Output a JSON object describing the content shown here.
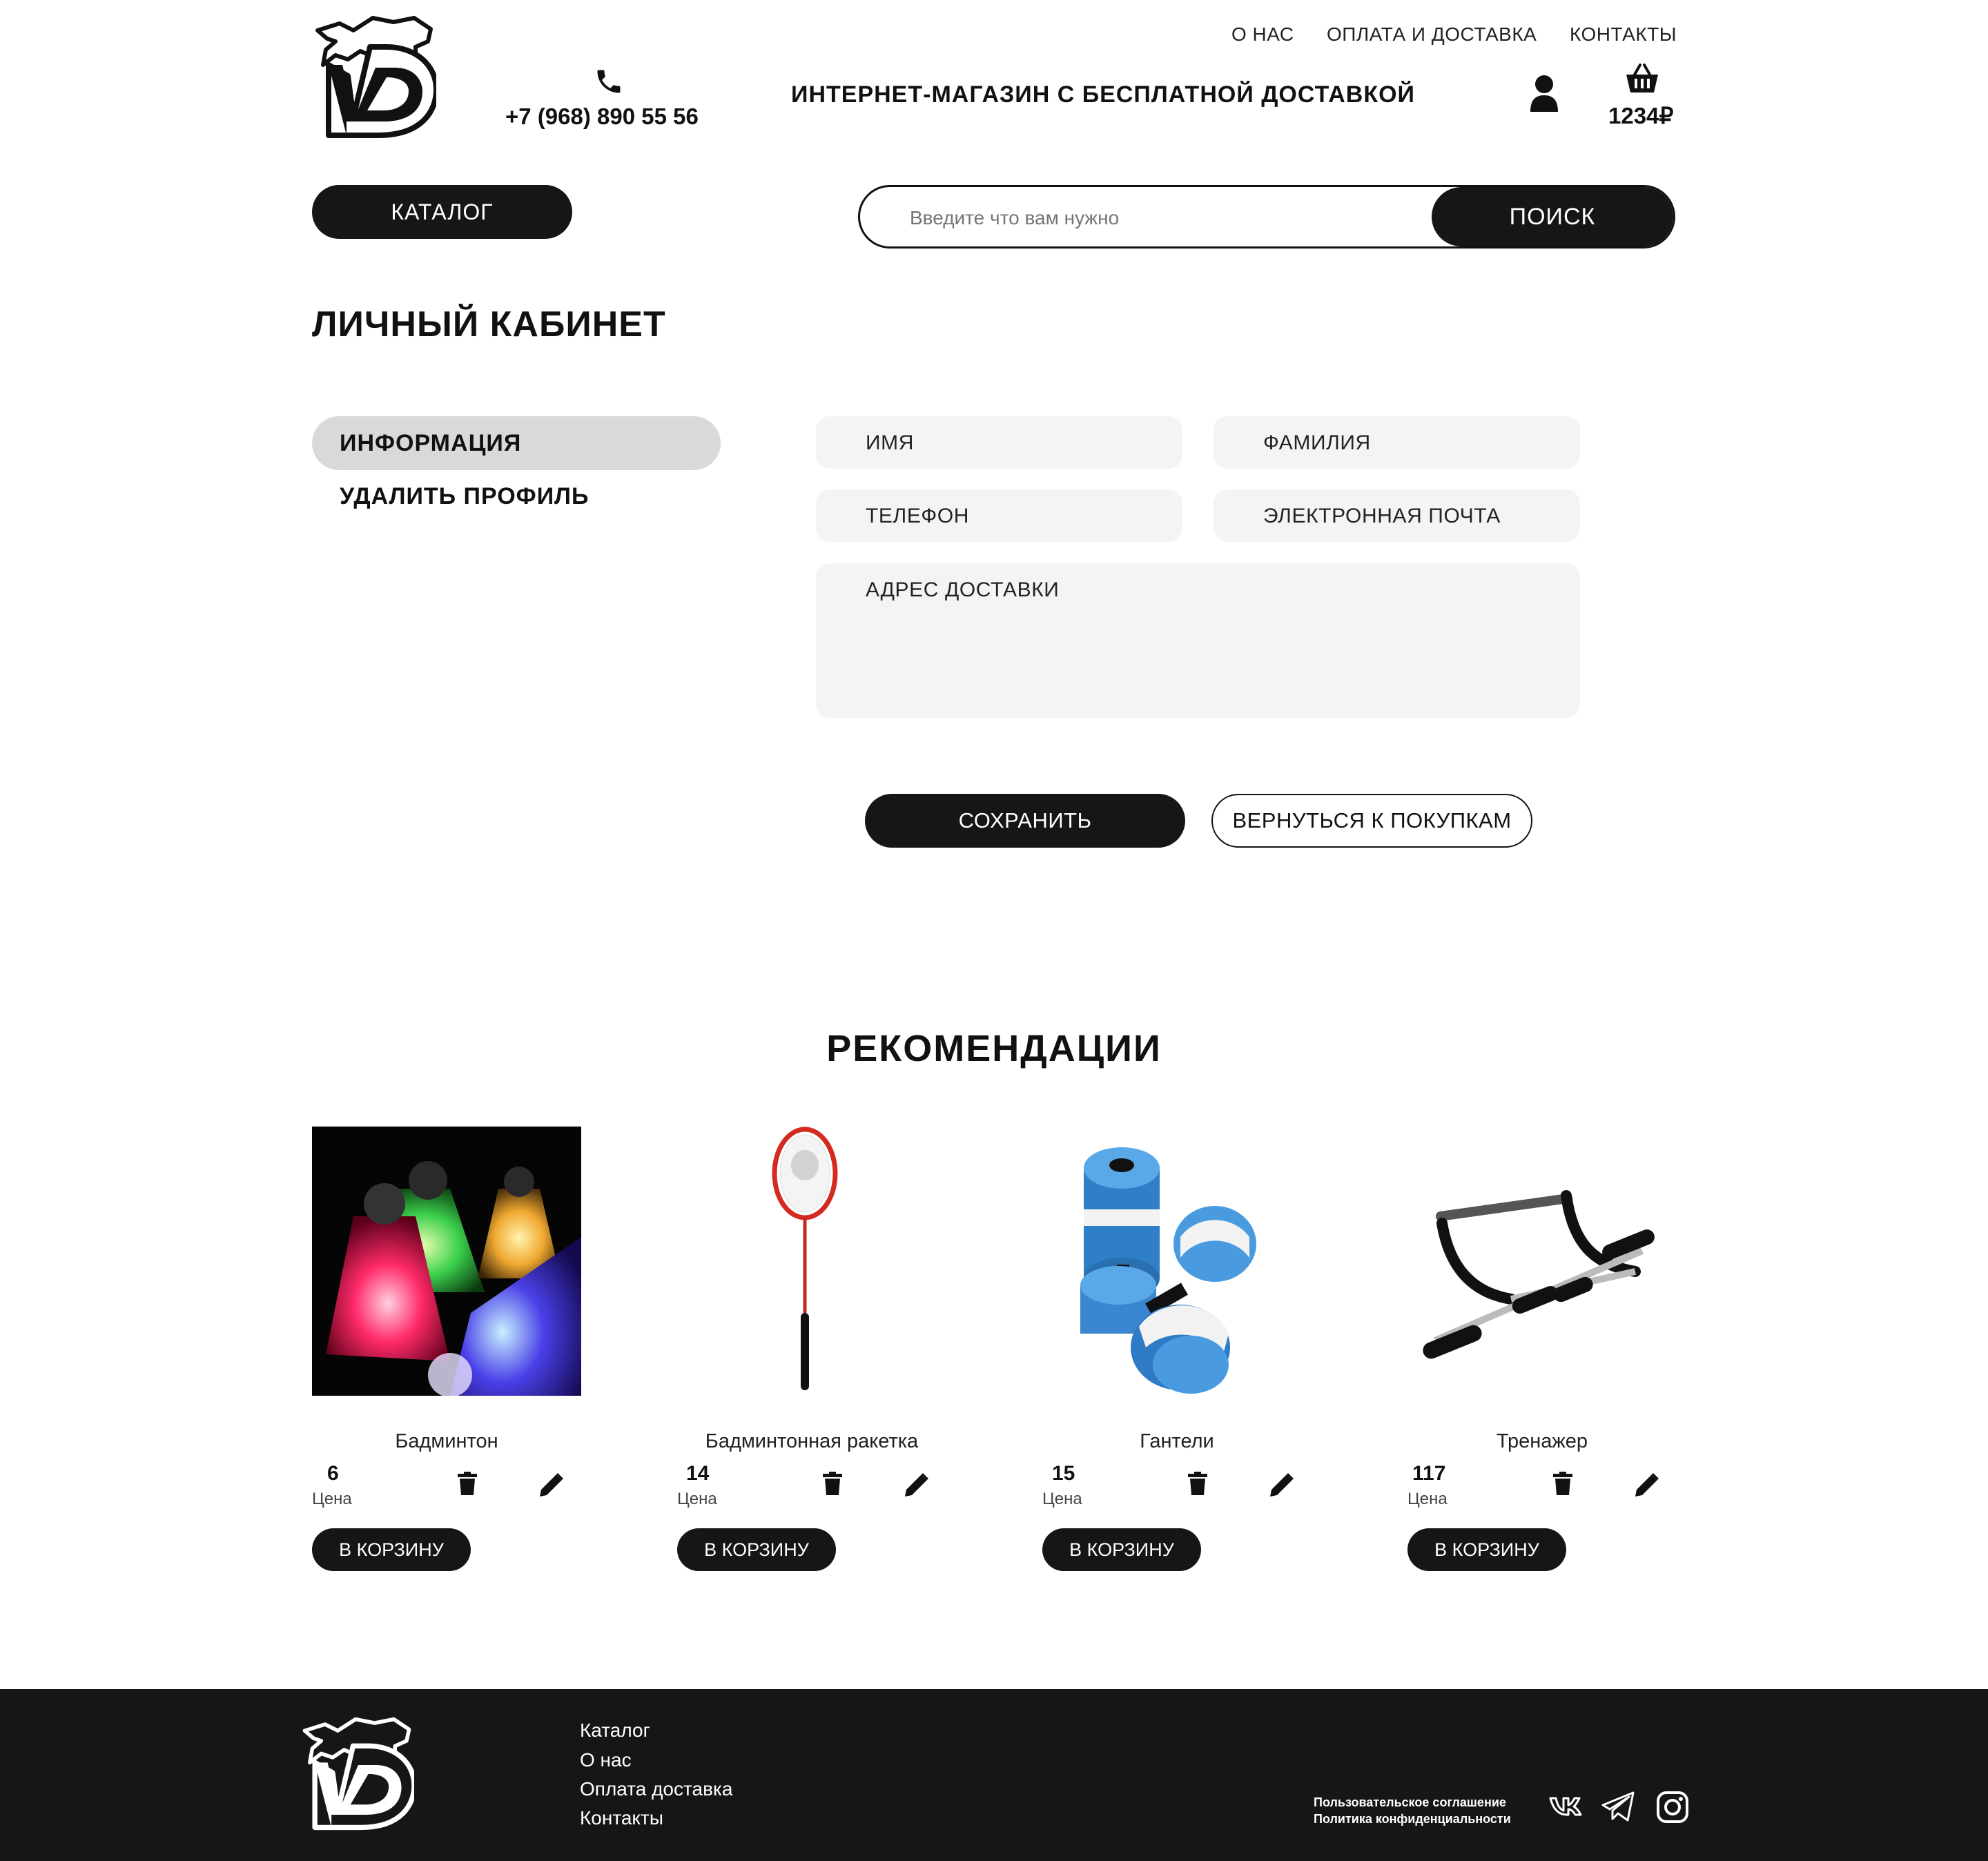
{
  "header": {
    "nav": [
      "О НАС",
      "ОПЛАТА И ДОСТАВКА",
      "КОНТАКТЫ"
    ],
    "phone": "+7 (968) 890 55 56",
    "tagline": "ИНТЕРНЕТ-МАГАЗИН С БЕСПЛАТНОЙ ДОСТАВКОЙ",
    "cart_total": "1234₽",
    "catalog_button": "КАТАЛОГ",
    "search": {
      "placeholder": "Введите что вам нужно",
      "button": "ПОИСК"
    }
  },
  "page_title": "ЛИЧНЫЙ КАБИНЕТ",
  "sidebar": {
    "items": [
      {
        "label": "ИНФОРМАЦИЯ",
        "active": true
      },
      {
        "label": "УДАЛИТЬ ПРОФИЛЬ",
        "active": false
      }
    ]
  },
  "form": {
    "first_name": "ИМЯ",
    "last_name": "ФАМИЛИЯ",
    "phone": "ТЕЛЕФОН",
    "email": "ЭЛЕКТРОННАЯ ПОЧТА",
    "address": "АДРЕС ДОСТАВКИ",
    "save_button": "СОХРАНИТЬ",
    "back_button": "ВЕРНУТЬСЯ К ПОКУПКАМ"
  },
  "recommendations": {
    "title": "РЕКОМЕНДАЦИИ",
    "price_label": "Цена",
    "cart_button": "В КОРЗИНУ",
    "products": [
      {
        "name": "Бадминтон",
        "price": "6"
      },
      {
        "name": "Бадминтонная ракетка",
        "price": "14"
      },
      {
        "name": "Гантели",
        "price": "15"
      },
      {
        "name": "Тренажер",
        "price": "117"
      }
    ]
  },
  "footer": {
    "links": [
      "Каталог",
      "О нас",
      "Оплата доставка",
      "Контакты"
    ],
    "legal": [
      "Пользовательское соглашение",
      "Политика конфиденциальности"
    ]
  },
  "colors": {
    "dark": "#161616",
    "field": "#f4f4f4",
    "active_tab": "#d9d9d9"
  },
  "icons": [
    "logo",
    "phone-icon",
    "user-icon",
    "basket-icon",
    "trash-icon",
    "pencil-icon",
    "vk-icon",
    "telegram-icon",
    "instagram-icon"
  ]
}
